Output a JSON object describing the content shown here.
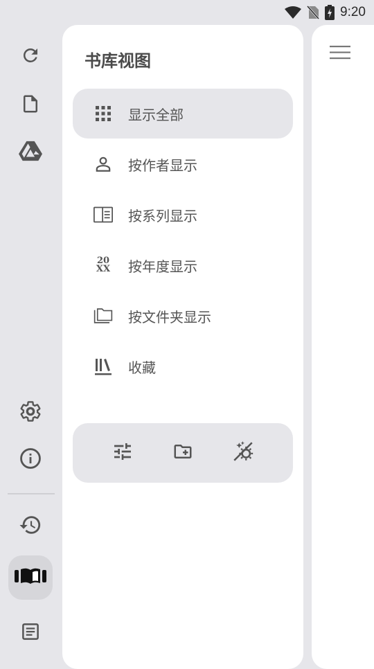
{
  "status_bar": {
    "time": "9:20"
  },
  "rail": {
    "top_items": [
      "refresh-icon",
      "file-icon",
      "drive-icon"
    ],
    "bottom_items": [
      "settings-icon",
      "info-icon",
      "history-icon",
      "library-icon",
      "notes-icon"
    ],
    "active": "library-icon"
  },
  "drawer": {
    "title": "书库视图",
    "items": [
      {
        "label": "显示全部",
        "icon": "grid-icon",
        "selected": true
      },
      {
        "label": "按作者显示",
        "icon": "person-icon"
      },
      {
        "label": "按系列显示",
        "icon": "series-icon"
      },
      {
        "label": "按年度显示",
        "icon": "year-icon",
        "icon_text_top": "20",
        "icon_text_bottom": "XX"
      },
      {
        "label": "按文件夹显示",
        "icon": "folders-icon"
      },
      {
        "label": "收藏",
        "icon": "bookshelf-icon"
      }
    ],
    "actions": [
      "tune-icon",
      "new-folder-icon",
      "theme-toggle-icon"
    ]
  },
  "colors": {
    "background": "#e6e6ea",
    "panel": "#ffffff",
    "selected": "#e6e6ea",
    "icon": "#555555"
  }
}
